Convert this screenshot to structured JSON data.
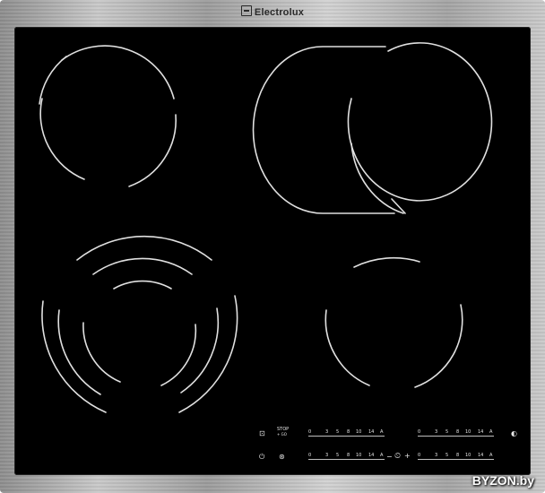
{
  "brand": {
    "name": "Electrolux"
  },
  "controls": {
    "stop_label": "STOP",
    "stop_sub": "+ GO",
    "scales": [
      {
        "ticks": [
          "0",
          "3",
          "5",
          "8",
          "10",
          "14",
          "A"
        ]
      },
      {
        "ticks": [
          "0",
          "3",
          "5",
          "8",
          "10",
          "14",
          "A"
        ]
      },
      {
        "ticks": [
          "0",
          "3",
          "5",
          "8",
          "10",
          "14",
          "A"
        ]
      },
      {
        "ticks": [
          "0",
          "3",
          "5",
          "8",
          "10",
          "14",
          "A"
        ]
      }
    ],
    "timer_minus": "−",
    "timer_plus": "+"
  },
  "watermark": "BYZON.by",
  "colors": {
    "glass": "#000000",
    "frame": "#b5b5b5",
    "zone_line": "#e0e0e0"
  },
  "icons": [
    "lock-icon",
    "stop-go-icon",
    "power-icon",
    "bridge-icon",
    "timer-icon",
    "zone-extend-icon"
  ]
}
